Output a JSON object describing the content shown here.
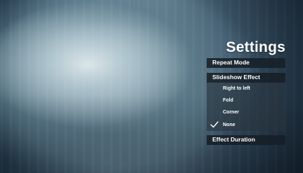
{
  "settings": {
    "title": "Settings",
    "repeat_mode_label": "Repeat Mode",
    "slideshow_effect_label": "Slideshow Effect",
    "effect_duration_label": "Effect Duration",
    "slideshow_effect_options": [
      {
        "label": "Right to left",
        "selected": false
      },
      {
        "label": "Fold",
        "selected": false
      },
      {
        "label": "Corner",
        "selected": false
      },
      {
        "label": "None",
        "selected": true
      }
    ]
  },
  "icons": {
    "selected_indicator": "checkmark-icon"
  }
}
